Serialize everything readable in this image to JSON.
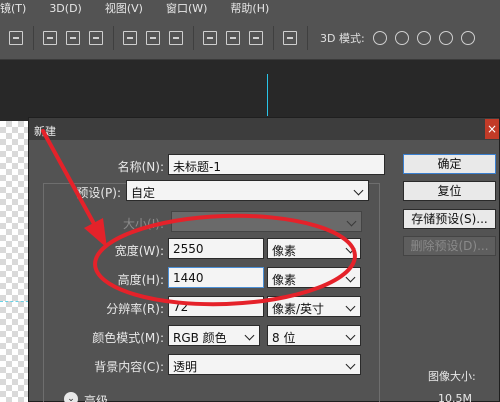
{
  "menubar": {
    "items": [
      "镜(T)",
      "3D(D)",
      "视图(V)",
      "窗口(W)",
      "帮助(H)"
    ]
  },
  "optionsbar": {
    "mode_label": "3D 模式:"
  },
  "dialog": {
    "title": "新建",
    "close_glyph": "×",
    "name_label": "名称(N):",
    "name_value": "未标题-1",
    "preset_label": "预设(P):",
    "preset_value": "自定",
    "size_label": "大小(I):",
    "width_label": "宽度(W):",
    "width_value": "2550",
    "width_unit": "像素",
    "height_label": "高度(H):",
    "height_value": "1440",
    "height_unit": "像素",
    "resolution_label": "分辨率(R):",
    "resolution_value": "72",
    "resolution_unit": "像素/英寸",
    "color_mode_label": "颜色模式(M):",
    "color_mode_value": "RGB 颜色",
    "bit_depth_value": "8 位",
    "background_label": "背景内容(C):",
    "background_value": "透明",
    "advanced_label": "高级",
    "advanced_glyph": "⌄",
    "buttons": {
      "ok": "确定",
      "reset": "复位",
      "save_preset": "存储预设(S)...",
      "delete_preset": "删除预设(D)..."
    },
    "image_size_label": "图像大小:",
    "image_size_value": "10.5M"
  },
  "colors": {
    "annotation_red": "#e5222a",
    "guide_cyan": "#29c4e8",
    "dialog_bg": "#535353"
  },
  "icons": [
    "align-icon",
    "distribute-icon",
    "3d-mode-icon"
  ]
}
